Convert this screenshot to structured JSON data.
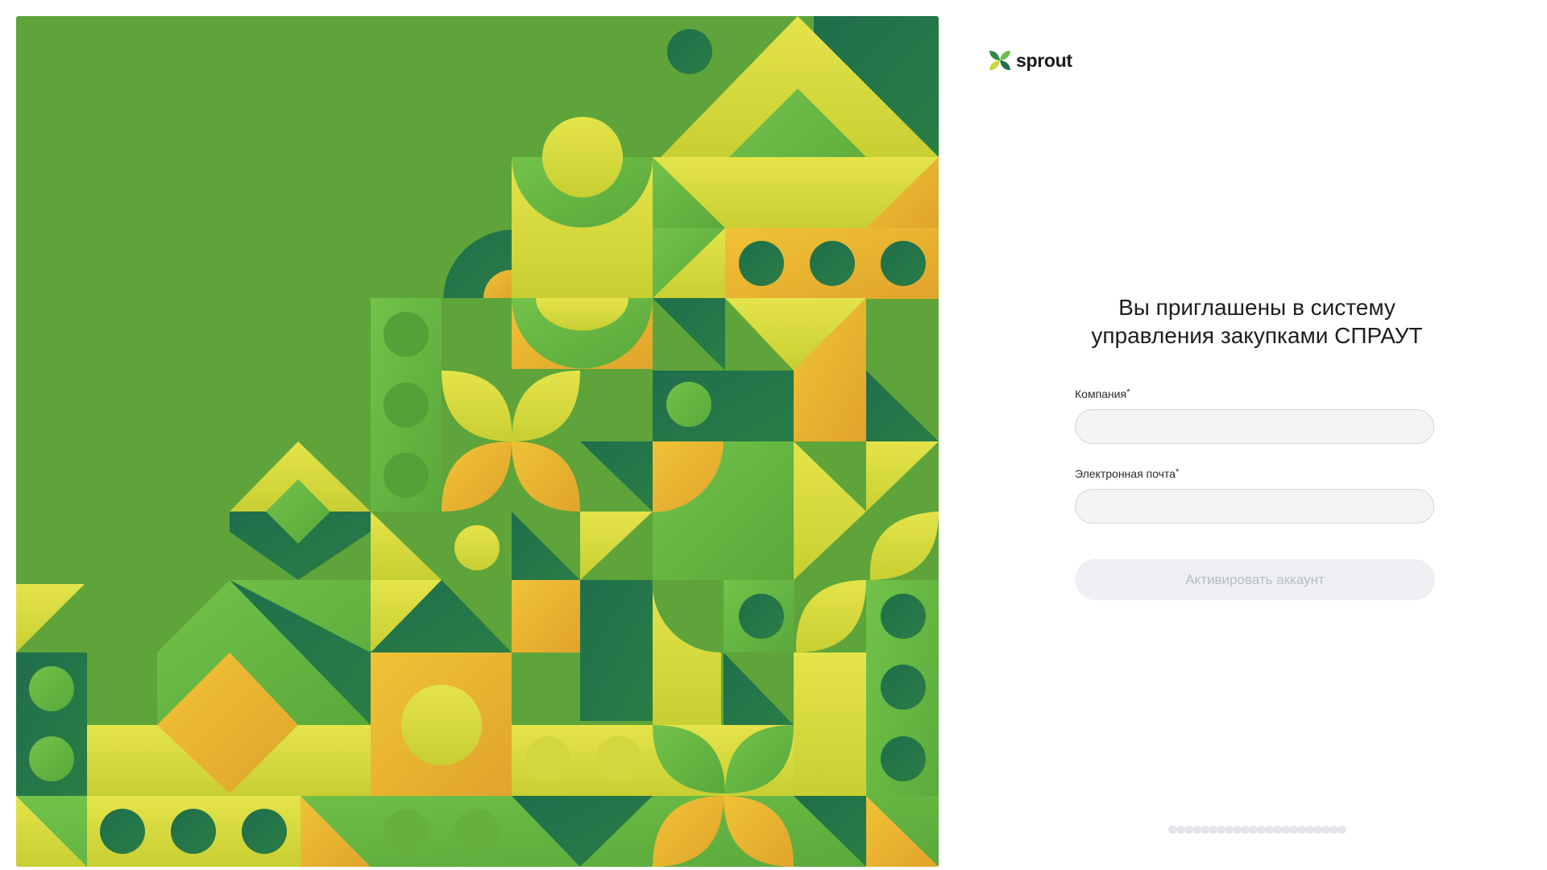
{
  "brand": {
    "name": "sprout",
    "logo_icon": "sprout-leaf-icon"
  },
  "illustration": {
    "name": "geometric-pattern-illustration",
    "palette": [
      "#5ea43a",
      "#1f6e4c",
      "#c9d83c",
      "#e8b834",
      "#6cc04a"
    ]
  },
  "heading": {
    "line1": "Вы приглашены в систему",
    "line2": "управления закупками СПРАУТ"
  },
  "form": {
    "company": {
      "label": "Компания",
      "required_mark": "*",
      "value": "",
      "placeholder": ""
    },
    "email": {
      "label": "Электронная почта",
      "required_mark": "*",
      "value": "",
      "placeholder": ""
    },
    "submit_label": "Активировать аккаунт"
  },
  "colors": {
    "button_bg": "#eef0f3",
    "button_text": "#b9bdc4",
    "input_bg": "#f3f4f6",
    "input_border": "#d5d6db"
  }
}
